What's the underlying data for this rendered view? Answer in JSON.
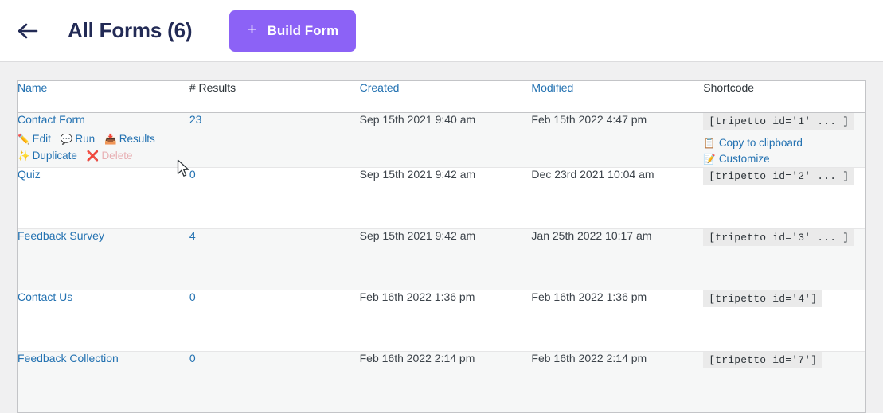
{
  "header": {
    "back_icon": "arrow-left-icon",
    "title": "All Forms (6)",
    "build_button": {
      "label": "Build Form",
      "plus": "+",
      "color": "#8c62f6"
    }
  },
  "table": {
    "columns": [
      {
        "key": "name",
        "label": "Name",
        "sortable": true
      },
      {
        "key": "results",
        "label": "# Results",
        "sortable": false
      },
      {
        "key": "created",
        "label": "Created",
        "sortable": true
      },
      {
        "key": "modified",
        "label": "Modified",
        "sortable": true
      },
      {
        "key": "shortcode",
        "label": "Shortcode",
        "sortable": false
      }
    ],
    "row_action_labels": {
      "edit": "Edit",
      "run": "Run",
      "results": "Results",
      "duplicate": "Duplicate",
      "delete": "Delete",
      "copy": "Copy to clipboard",
      "customize": "Customize"
    },
    "row_action_icons": {
      "edit": "pencil-icon",
      "run": "speech-bubble-icon",
      "results": "inbox-tray-icon",
      "duplicate": "sparkles-icon",
      "delete": "cross-mark-icon",
      "copy": "clipboard-icon",
      "customize": "memo-icon"
    },
    "rows": [
      {
        "name": "Contact Form",
        "results": "23",
        "created": "Sep 15th 2021 9:40 am",
        "modified": "Feb 15th 2022 4:47 pm",
        "shortcode": "[tripetto id='1' ... ]",
        "has_actions": true
      },
      {
        "name": "Quiz",
        "results": "0",
        "created": "Sep 15th 2021 9:42 am",
        "modified": "Dec 23rd 2021 10:04 am",
        "shortcode": "[tripetto id='2' ... ]",
        "has_actions": false
      },
      {
        "name": "Feedback Survey",
        "results": "4",
        "created": "Sep 15th 2021 9:42 am",
        "modified": "Jan 25th 2022 10:17 am",
        "shortcode": "[tripetto id='3' ... ]",
        "has_actions": false
      },
      {
        "name": "Contact Us",
        "results": "0",
        "created": "Feb 16th 2022 1:36 pm",
        "modified": "Feb 16th 2022 1:36 pm",
        "shortcode": "[tripetto id='4']",
        "has_actions": false
      },
      {
        "name": "Feedback Collection",
        "results": "0",
        "created": "Feb 16th 2022 2:14 pm",
        "modified": "Feb 16th 2022 2:14 pm",
        "shortcode": "[tripetto id='7']",
        "has_actions": false
      }
    ]
  },
  "cursor": {
    "icon": "mouse-pointer-icon"
  }
}
